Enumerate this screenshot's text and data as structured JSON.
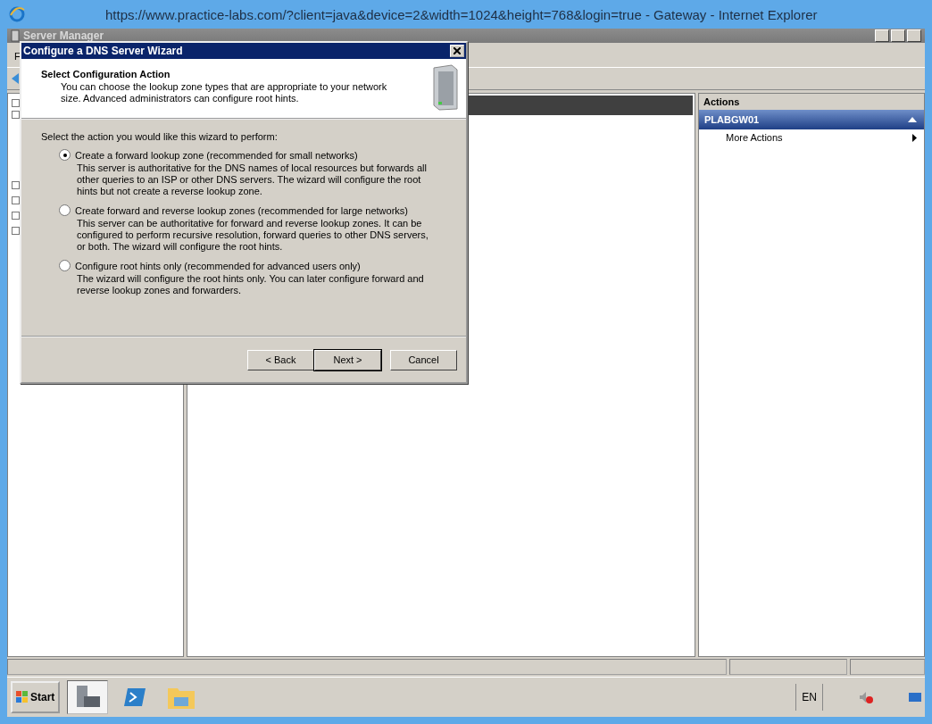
{
  "browser": {
    "title": "https://www.practice-labs.com/?client=java&device=2&width=1024&height=768&login=true - Gateway  - Internet Explorer"
  },
  "server_manager": {
    "title": "Server Manager",
    "menu": [
      "F"
    ]
  },
  "actions_pane": {
    "title": "Actions",
    "group": {
      "label": "PLABGW01",
      "expanded": true
    },
    "items": [
      "More Actions"
    ]
  },
  "dialog": {
    "title": "Configure a DNS Server Wizard",
    "heading": "Select Configuration Action",
    "description": "You can choose the lookup zone types that are appropriate to your network size. Advanced administrators can configure root hints.",
    "prompt": "Select the action you would like this wizard to perform:",
    "options": [
      {
        "label": "Create a forward lookup zone (recommended for small networks)",
        "description": "This server is authoritative for the DNS names of local resources but forwards all other queries to an ISP or other DNS servers. The wizard will configure the root hints but not create a reverse lookup zone.",
        "selected": true
      },
      {
        "label": "Create forward and reverse lookup zones (recommended for large networks)",
        "description": "This server can be authoritative for forward and reverse lookup zones. It can be configured to perform recursive resolution, forward queries to other DNS servers, or both. The wizard will configure the root hints.",
        "selected": false
      },
      {
        "label": "Configure root hints only (recommended for advanced users only)",
        "description": "The wizard will configure the root hints only. You can later configure forward and reverse lookup zones and forwarders.",
        "selected": false
      }
    ],
    "buttons": [
      {
        "label": "< Back",
        "default": false
      },
      {
        "label": "Next >",
        "default": true
      },
      {
        "label": "Cancel",
        "default": false
      }
    ]
  },
  "taskbar": {
    "start": "Start",
    "language": "EN"
  }
}
